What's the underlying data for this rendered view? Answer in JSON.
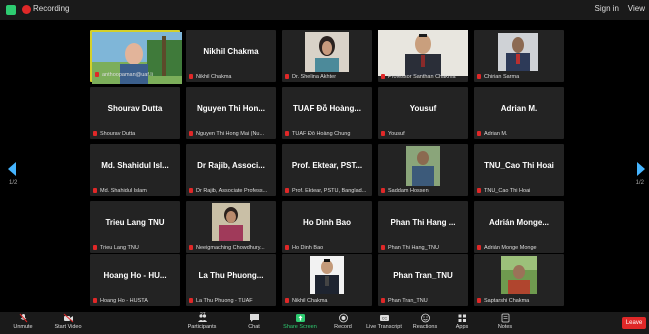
{
  "topbar": {
    "recording_label": "Recording",
    "sign_in": "Sign in",
    "view": "View"
  },
  "pagination": {
    "left": "1/2",
    "right": "1/2"
  },
  "tiles": [
    {
      "name": "",
      "label": "anthoopaman@uaf.li"
    },
    {
      "name": "Nikhil Chakma",
      "label": "Nikhil Chakma"
    },
    {
      "name": "",
      "label": "Dr. Shelina Akhter"
    },
    {
      "name": "",
      "label": "Professor Santhan Chakma"
    },
    {
      "name": "",
      "label": "Chirian Sarma"
    },
    {
      "name": "Shourav Dutta",
      "label": "Shourav Dutta"
    },
    {
      "name": "Nguyen Thi Hon...",
      "label": "Nguyen Thi Hong Mai (Nu..."
    },
    {
      "name": "TUAF Đỗ Hoàng...",
      "label": "TUAF Đỗ Hoàng Chung"
    },
    {
      "name": "Yousuf",
      "label": "Yousuf"
    },
    {
      "name": "Adrian M.",
      "label": "Adrian M."
    },
    {
      "name": "Md. Shahidul Isl...",
      "label": "Md. Shahidul Islam"
    },
    {
      "name": "Dr Rajib, Associ...",
      "label": "Dr Rajib, Associate Profess..."
    },
    {
      "name": "Prof. Ektear, PST...",
      "label": "Prof. Ektear, PSTU, Banglad..."
    },
    {
      "name": "",
      "label": "Saddam Hossen"
    },
    {
      "name": "TNU_Cao Thi Hoai",
      "label": "TNU_Cao Thi Hoai"
    },
    {
      "name": "Trieu Lang TNU",
      "label": "Trieu Lang TNU"
    },
    {
      "name": "",
      "label": "Neeigmaching Chowdhury..."
    },
    {
      "name": "Ho Dinh Bao",
      "label": "Ho Dinh Bao"
    },
    {
      "name": "Phan Thi Hang ...",
      "label": "Phan Thi Hang_TNU"
    },
    {
      "name": "Adrián Monge...",
      "label": "Adrián Monge Monge"
    },
    {
      "name": "Hoang Ho - HU...",
      "label": "Hoang Ho - HUSTA"
    },
    {
      "name": "La Thu Phuong...",
      "label": "La Thu Phuong - TUAF"
    },
    {
      "name": "",
      "label": "Nikhil Chakma"
    },
    {
      "name": "Phan Tran_TNU",
      "label": "Phan Tran_TNU"
    },
    {
      "name": "",
      "label": "Saptarshi Chakma"
    }
  ],
  "toolbar": {
    "unmute": "Unmute",
    "start_video": "Start Video",
    "participants": "Participants",
    "participants_count": "27",
    "chat": "Chat",
    "share_screen": "Share Screen",
    "record": "Record",
    "live_transcript": "Live Transcript",
    "reactions": "Reactions",
    "apps": "Apps",
    "notes": "Notes",
    "leave": "Leave"
  },
  "colors": {
    "active_speaker": "#d4d02a",
    "nav_arrow": "#46b5ff",
    "leave": "#e02828",
    "share": "#2ecc71"
  }
}
